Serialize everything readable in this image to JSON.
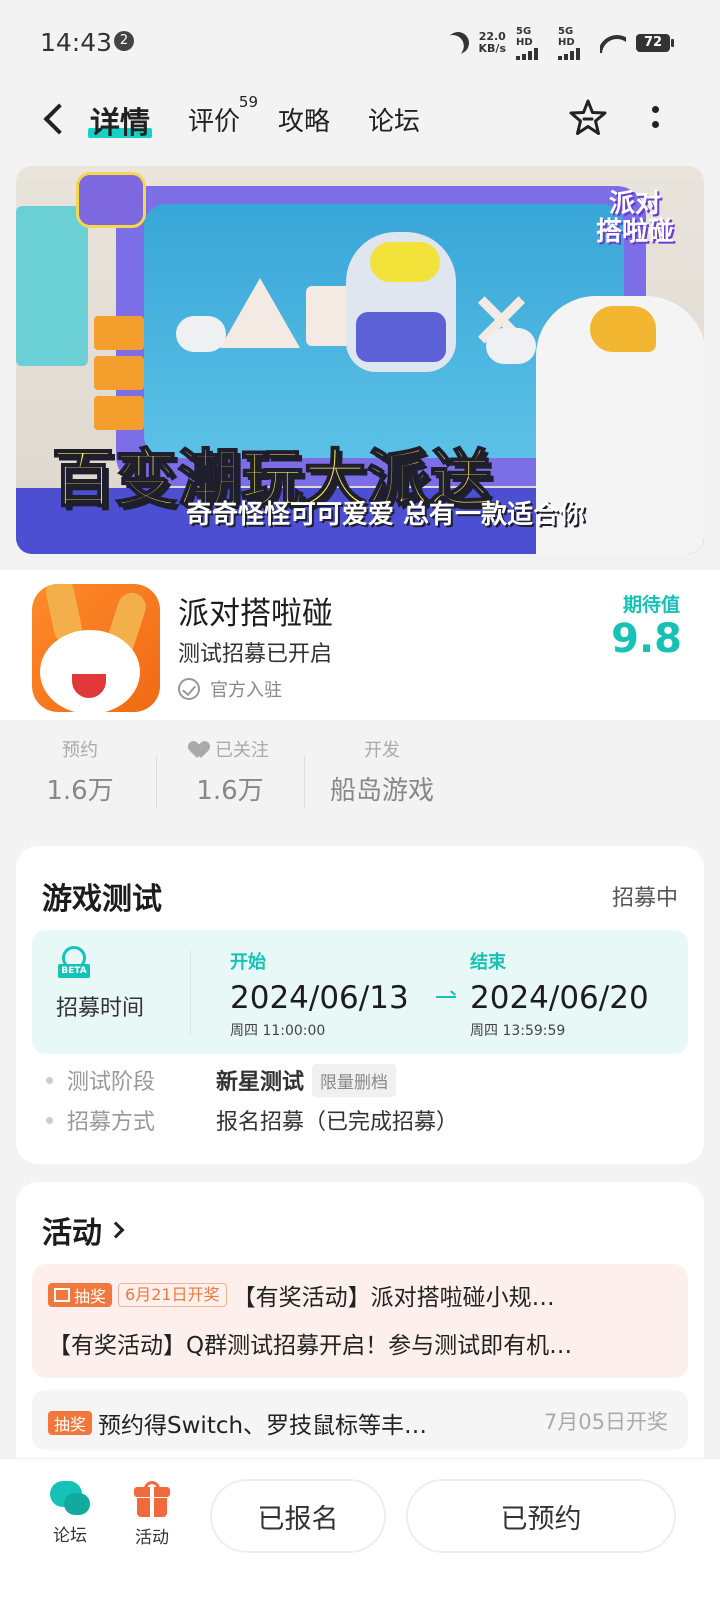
{
  "status_bar": {
    "time": "14:43",
    "notification_count": "2",
    "net_speed_value": "22.0",
    "net_speed_unit": "KB/s",
    "signal1": "5G HD",
    "signal2": "5G HD",
    "battery": "72"
  },
  "nav": {
    "tabs": [
      {
        "label": "详情"
      },
      {
        "label": "评价",
        "badge": "59"
      },
      {
        "label": "攻略"
      },
      {
        "label": "论坛"
      }
    ]
  },
  "banner": {
    "logo_line1": "派对",
    "logo_line2": "搭啦碰",
    "headline": "百变潮玩大派送",
    "subline": "奇奇怪怪可可爱爱 总有一款适合你"
  },
  "app": {
    "name": "派对搭啦碰",
    "status": "测试招募已开启",
    "official": "官方入驻",
    "expect_label": "期待值",
    "expect_value": "9.8"
  },
  "stats": [
    {
      "label": "预约",
      "value": "1.6万"
    },
    {
      "label": "已关注",
      "value": "1.6万"
    },
    {
      "label": "开发",
      "value": "船岛游戏"
    }
  ],
  "test": {
    "title": "游戏测试",
    "status": "招募中",
    "beta_tag": "BETA",
    "time_label": "招募时间",
    "start_label": "开始",
    "start_date": "2024/06/13",
    "start_week": "周四  11:00:00",
    "end_label": "结束",
    "end_date": "2024/06/20",
    "end_week": "周四  13:59:59",
    "stage_label": "测试阶段",
    "stage_value": "新星测试",
    "stage_chip": "限量删档",
    "method_label": "招募方式",
    "method_value": "报名招募（已完成招募）"
  },
  "activity": {
    "title": "活动",
    "lottery_tag": "抽奖",
    "item1_date": "6月21日开奖",
    "item1_text": "【有奖活动】派对搭啦碰小规…",
    "item2_text": "【有奖活动】Q群测试招募开启！参与测试即有机…",
    "item3_text": "预约得Switch、罗技鼠标等丰…",
    "item3_date": "7月05日开奖"
  },
  "bottom_bar": {
    "forum_label": "论坛",
    "activity_label": "活动",
    "registered_label": "已报名",
    "reserved_label": "已预约"
  },
  "colors": {
    "accent": "#16c2b5",
    "orange": "#f0783c"
  }
}
